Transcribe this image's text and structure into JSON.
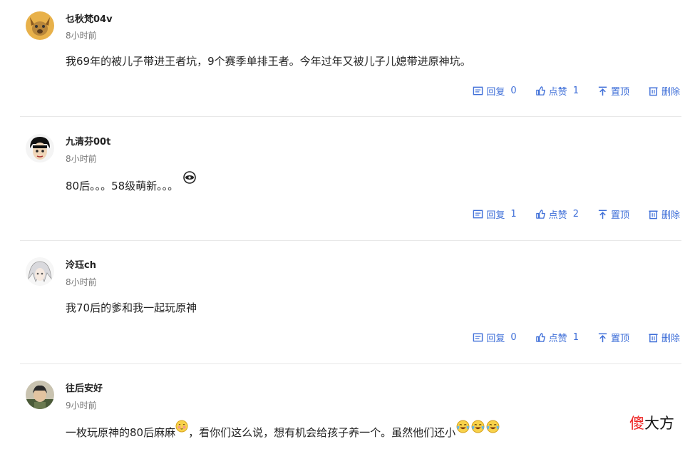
{
  "comments": [
    {
      "username": "乜秋梵04v",
      "time": "8小时前",
      "text": "我69年的被儿子带进王者坑，9个赛季单排王者。今年过年又被儿子儿媳带进原神坑。",
      "reply_label": "回复",
      "reply_count": "0",
      "like_label": "点赞",
      "like_count": "1",
      "pin_label": "置顶",
      "delete_label": "删除"
    },
    {
      "username": "九清芬00t",
      "time": "8小时前",
      "text": "80后。。。58级萌新。。。",
      "reply_label": "回复",
      "reply_count": "1",
      "like_label": "点赞",
      "like_count": "2",
      "pin_label": "置顶",
      "delete_label": "删除"
    },
    {
      "username": "泠珏ch",
      "time": "8小时前",
      "text": "我70后的爹和我一起玩原神",
      "reply_label": "回复",
      "reply_count": "0",
      "like_label": "点赞",
      "like_count": "1",
      "pin_label": "置顶",
      "delete_label": "删除"
    },
    {
      "username": "往后安好",
      "time": "9小时前",
      "text_part1": "一枚玩原神的80后麻麻",
      "text_part2": "，看你们这么说，想有机会给孩子养一个。虽然他们还小"
    }
  ],
  "watermark": {
    "first": "傻",
    "rest": "大方"
  },
  "colors": {
    "action_blue": "#3f6fd8",
    "watermark_red": "#e22222"
  }
}
